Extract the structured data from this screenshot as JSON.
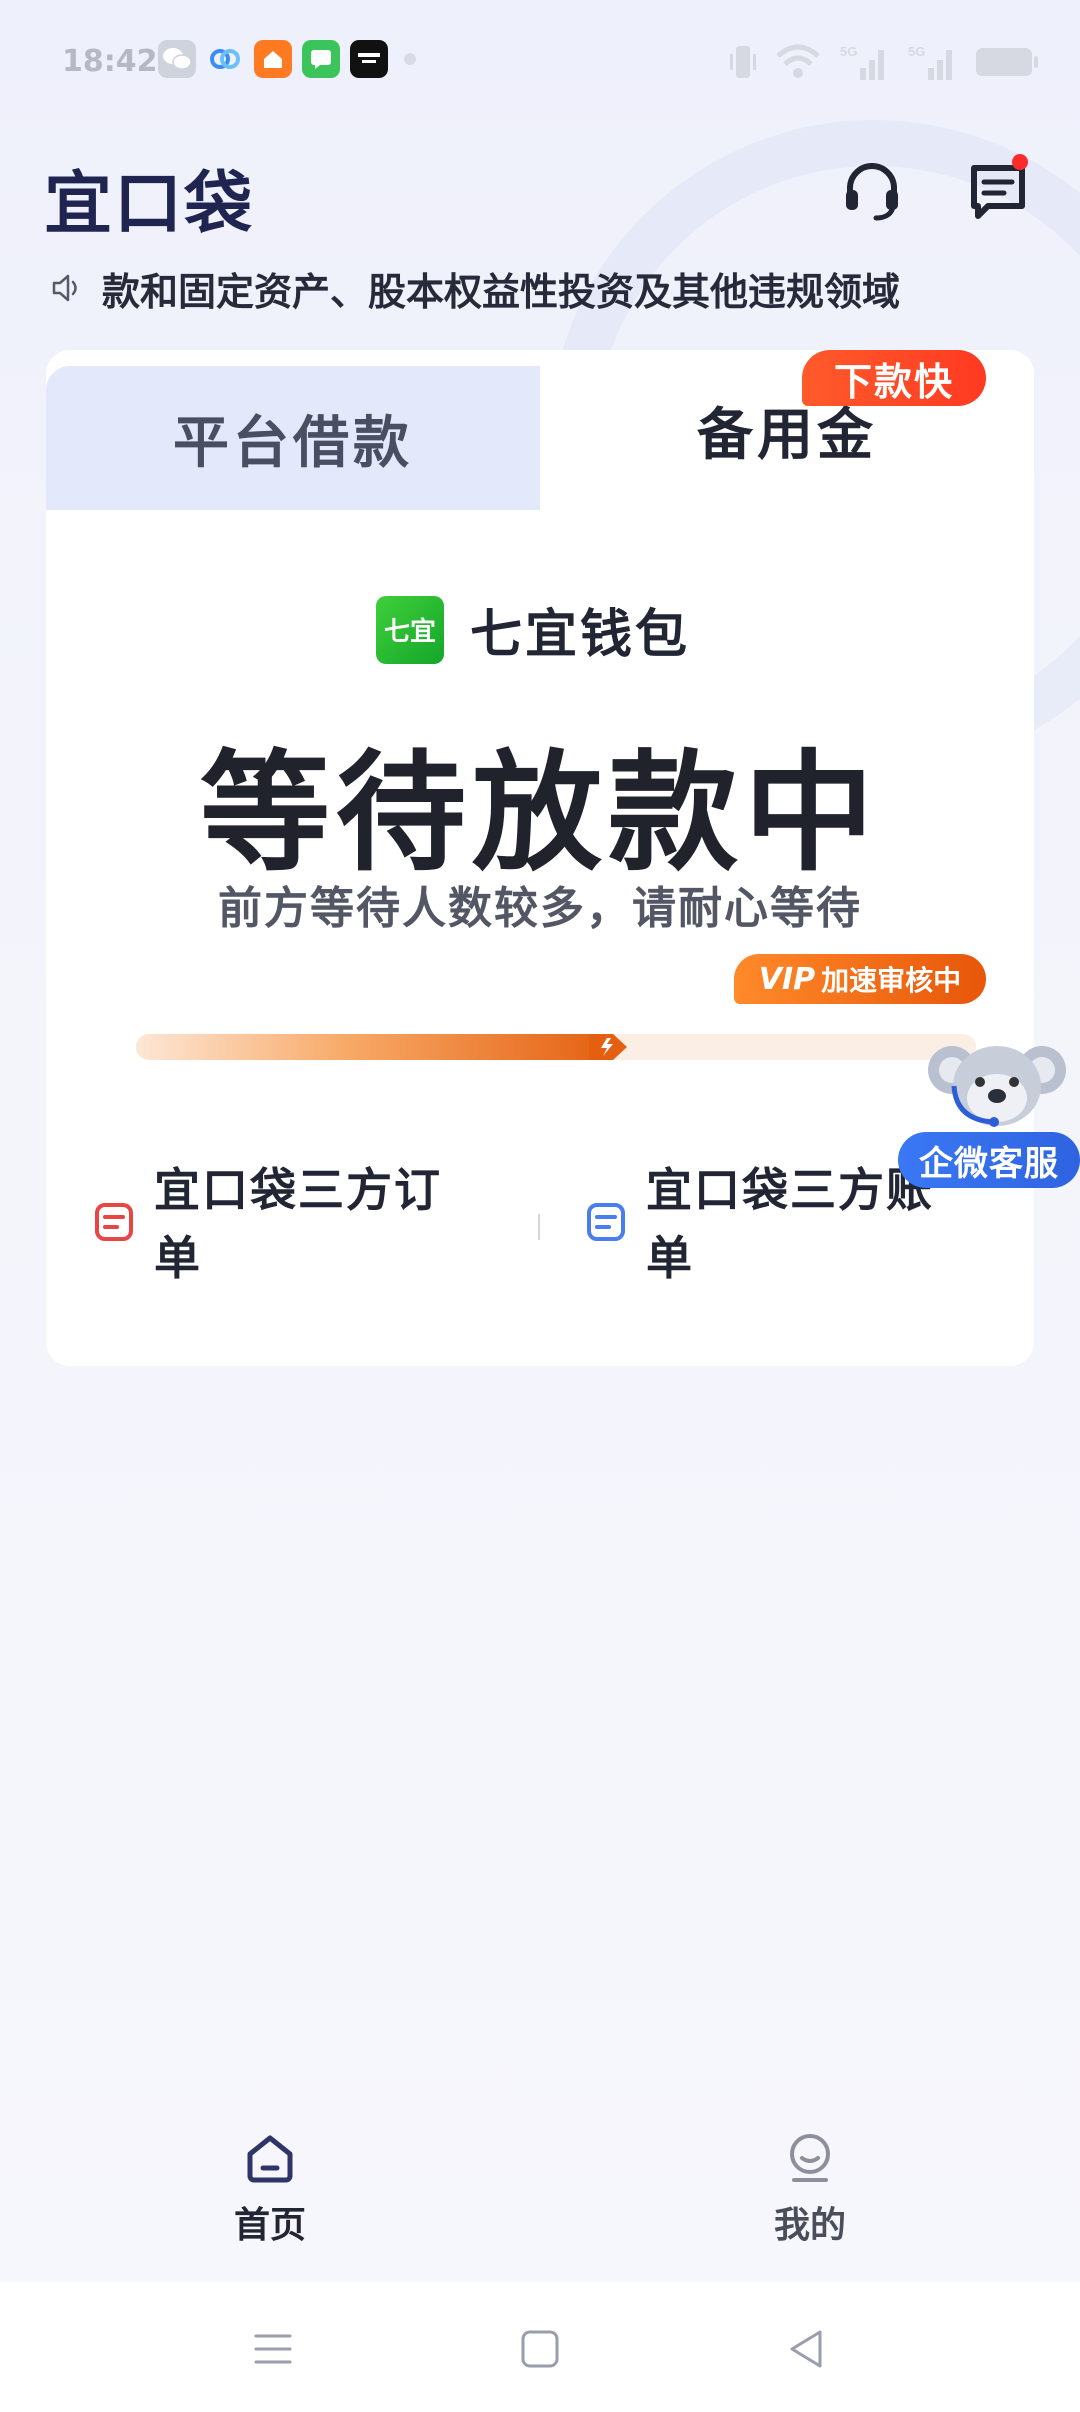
{
  "status_bar": {
    "time": "18:42",
    "network_1": "5G",
    "network_2": "5G"
  },
  "header": {
    "brand": "宜口袋"
  },
  "notice": {
    "text": "款和固定资产、股本权益性投资及其他违规领域"
  },
  "tabs": {
    "left_label": "平台借款",
    "right_label": "备用金",
    "badge": "下款快"
  },
  "wallet": {
    "logo_text": "七宜",
    "name": "七宜钱包"
  },
  "status": {
    "title": "等待放款中",
    "subtitle": "前方等待人数较多，请耐心等待"
  },
  "vip": {
    "tag": "VIP",
    "text": "加速审核中",
    "progress": 0.57
  },
  "links": {
    "left_label": "宜口袋三方订单",
    "right_label": "宜口袋三方账单"
  },
  "support_float": {
    "label": "企微客服"
  },
  "bottom_nav": {
    "home_label": "首页",
    "mine_label": "我的"
  },
  "colors": {
    "brand": "#1f2550",
    "accent_orange": "#e8560a",
    "badge_red": "#ff3a22",
    "tab_inactive_bg": "#e4e8fb",
    "cs_blue": "#3a78f5"
  }
}
